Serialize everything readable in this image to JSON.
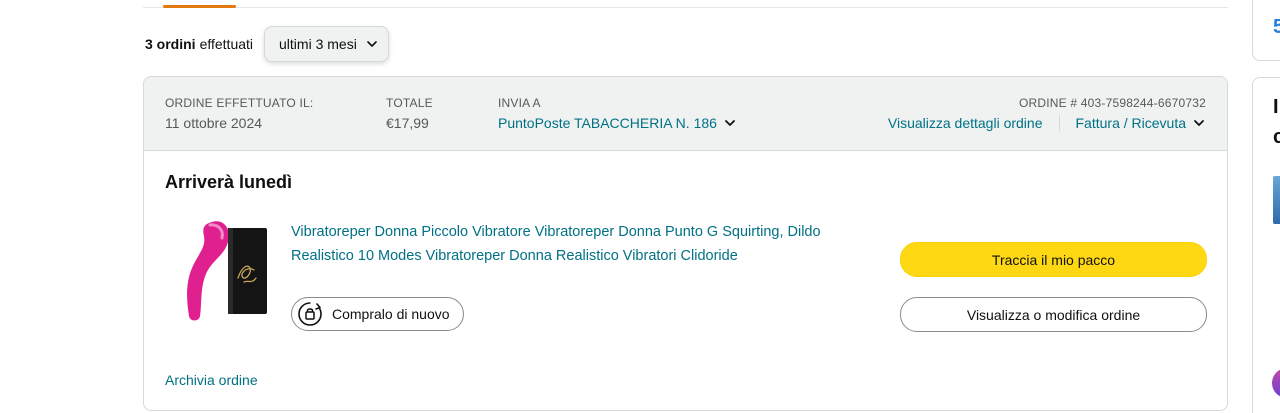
{
  "filter": {
    "count_label": "3 ordini",
    "count_suffix": "effettuati",
    "range_value": "ultimi 3 mesi"
  },
  "order": {
    "placed_label": "ORDINE EFFETTUATO IL:",
    "placed_date": "11 ottobre 2024",
    "total_label": "TOTALE",
    "total_value": "€17,99",
    "ship_label": "INVIA A",
    "ship_value": "PuntoPoste TABACCHERIA N. 186",
    "order_number_label": "ORDINE # 403-7598244-6670732",
    "details_link": "Visualizza dettagli ordine",
    "invoice_link": "Fattura / Ricevuta",
    "arrival": "Arriverà lunedì",
    "product_title": "Vibratoreper Donna Piccolo Vibratore Vibratoreper Donna Punto G Squirting, Dildo Realistico 10 Modes Vibratoreper Donna Realistico Vibratori Clidoride",
    "buy_again": "Compralo di nuovo",
    "track_button": "Traccia il mio pacco",
    "view_button": "Visualizza o modifica ordine",
    "archive_link": "Archivia ordine"
  },
  "side": {
    "glyph": "5",
    "text_1": "I",
    "text_2": "c"
  },
  "colors": {
    "link": "#007185",
    "primary_button": "#ffd814",
    "header_bg": "#f0f2f2",
    "tab_accent": "#e47911",
    "product_pink": "#e0208f"
  },
  "icons": {
    "range_chevron": "chevron-down-icon",
    "ship_chevron": "chevron-down-icon",
    "invoice_chevron": "chevron-down-icon",
    "buy_again_icon": "buy-again-icon"
  }
}
